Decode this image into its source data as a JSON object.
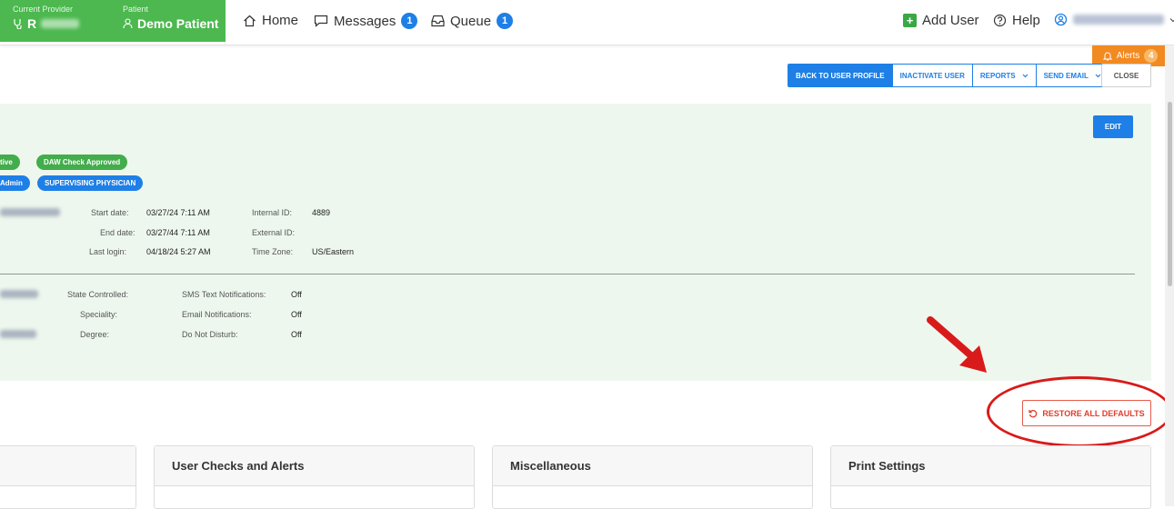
{
  "topbar": {
    "current_provider_label": "Current Provider",
    "provider_initial": "R",
    "patient_label": "Patient",
    "patient_name": "Demo Patient",
    "nav": {
      "home": "Home",
      "messages": "Messages",
      "messages_count": "1",
      "queue": "Queue",
      "queue_count": "1"
    },
    "add_user": "Add User",
    "help": "Help"
  },
  "alerts": {
    "label": "Alerts",
    "count": "4"
  },
  "actions": {
    "back_to_profile": "BACK TO USER PROFILE",
    "inactivate_user": "INACTIVATE USER",
    "reports": "REPORTS",
    "send_email": "SEND EMAIL",
    "close": "CLOSE"
  },
  "profile": {
    "edit": "EDIT",
    "pills": {
      "active": "tive",
      "daw": "DAW Check Approved",
      "admin": "Admin",
      "supervising": "SUPERVISING PHYSICIAN"
    },
    "start_date_label": "Start date:",
    "start_date": "03/27/24 7:11 AM",
    "end_date_label": "End date:",
    "end_date": "03/27/44 7:11 AM",
    "last_login_label": "Last login:",
    "last_login": "04/18/24 5:27 AM",
    "internal_id_label": "Internal ID:",
    "internal_id": "4889",
    "external_id_label": "External ID:",
    "external_id": "",
    "time_zone_label": "Time Zone:",
    "time_zone": "US/Eastern",
    "state_controlled_label": "State Controlled:",
    "speciality_label": "Speciality:",
    "degree_label": "Degree:",
    "sms_label": "SMS Text Notifications:",
    "sms_value": "Off",
    "email_notif_label": "Email Notifications:",
    "email_notif_value": "Off",
    "dnd_label": "Do Not Disturb:",
    "dnd_value": "Off"
  },
  "restore_defaults": "RESTORE ALL DEFAULTS",
  "cards": {
    "user_checks": "User Checks and Alerts",
    "misc": "Miscellaneous",
    "print": "Print Settings"
  },
  "colors": {
    "brand_green": "#4cb84f",
    "primary_blue": "#1e7fe6",
    "alert_orange": "#f28a22",
    "danger_red": "#e03c2c",
    "panel_bg": "#eef7ee"
  }
}
